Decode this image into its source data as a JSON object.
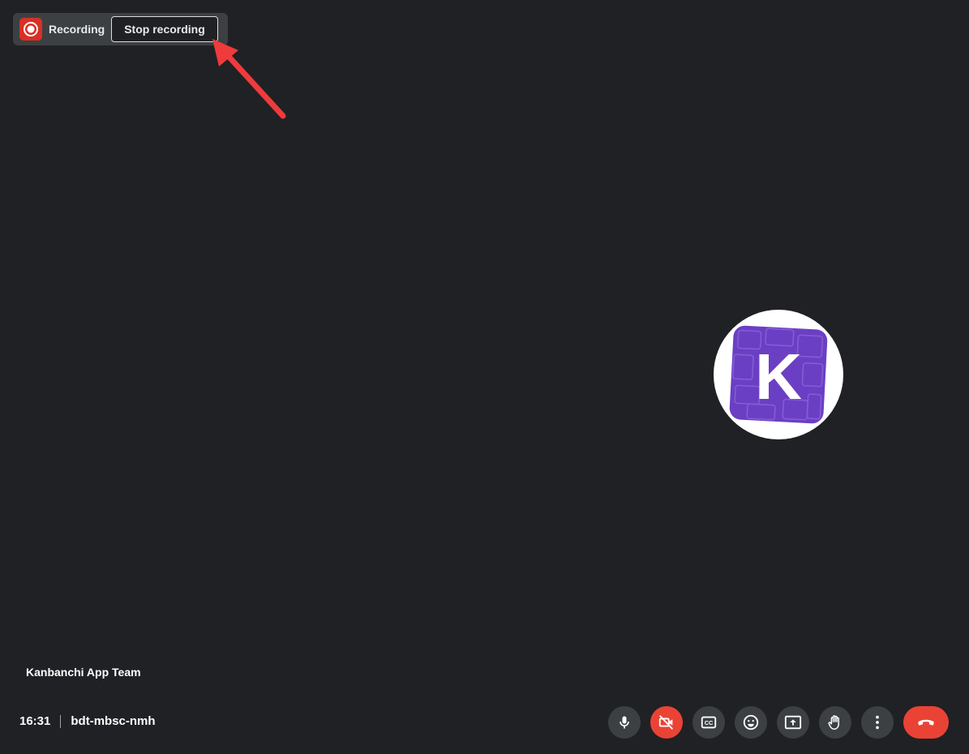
{
  "recording": {
    "label": "Recording",
    "stop_label": "Stop recording",
    "icon": "record-icon",
    "color": "#d93025"
  },
  "participant": {
    "name": "Kanbanchi App Team",
    "avatar_letter": "K",
    "avatar_color": "#6b3fc4"
  },
  "meeting": {
    "time": "16:31",
    "code": "bdt-mbsc-nmh"
  },
  "controls": [
    {
      "name": "microphone",
      "icon": "mic-icon"
    },
    {
      "name": "camera-off",
      "icon": "camera-off-icon",
      "color": "#ea4335"
    },
    {
      "name": "captions",
      "icon": "captions-icon"
    },
    {
      "name": "reactions",
      "icon": "emoji-icon"
    },
    {
      "name": "present-screen",
      "icon": "present-icon"
    },
    {
      "name": "raise-hand",
      "icon": "hand-icon"
    },
    {
      "name": "more-options",
      "icon": "more-vert-icon"
    },
    {
      "name": "leave-call",
      "icon": "call-end-icon",
      "color": "#ea4335"
    }
  ],
  "annotation": {
    "color": "#ef3b3b"
  }
}
